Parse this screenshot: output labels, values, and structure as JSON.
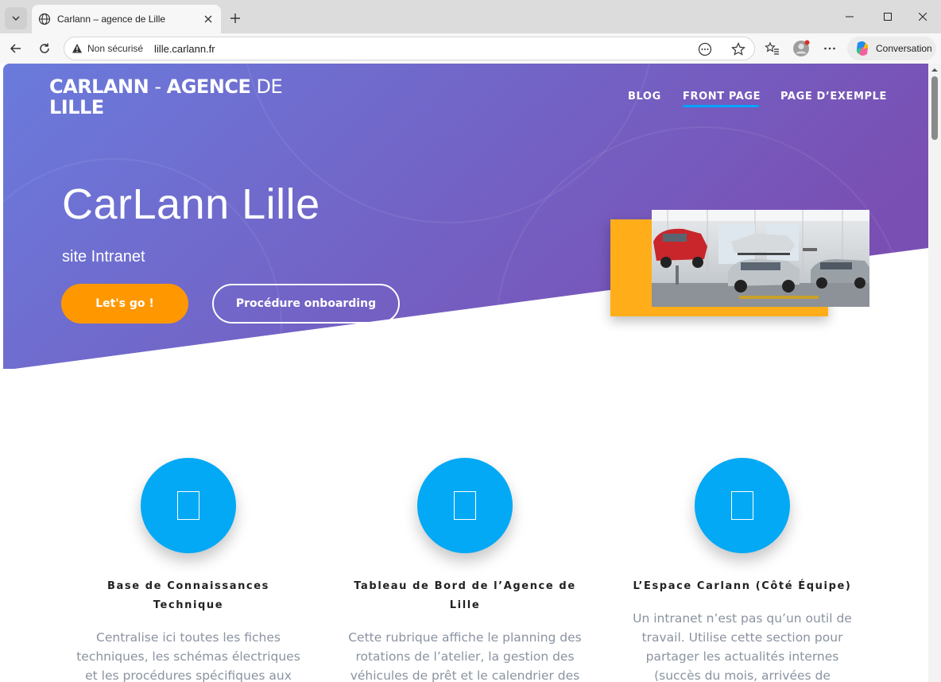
{
  "browser": {
    "tab_title": "Carlann – agence de Lille",
    "security_label": "Non sécurisé",
    "url": "lille.carlann.fr",
    "copilot_label": "Conversation"
  },
  "site": {
    "title_bold_1": "CARLANN",
    "title_sep": " - ",
    "title_bold_2": "AGENCE",
    "title_light": " DE",
    "title_bold_3": "LILLE",
    "nav": [
      {
        "label": "BLOG"
      },
      {
        "label": "FRONT PAGE",
        "active": true
      },
      {
        "label": "PAGE D’EXEMPLE"
      }
    ]
  },
  "hero": {
    "title": "CarLann Lille",
    "subtitle": "site Intranet",
    "primary_button": "Let's go !",
    "secondary_button": "Procédure onboarding"
  },
  "features": [
    {
      "icon": "document-icon",
      "title_lines": [
        "Base de Connaissances",
        "Technique"
      ],
      "text_lines": [
        "Centralise ici toutes les fiches",
        "techniques, les schémas électriques",
        "et les procédures spécifiques aux"
      ]
    },
    {
      "icon": "document-icon",
      "title_lines": [
        "Tableau de Bord de l’Agence de",
        "Lille"
      ],
      "text_lines": [
        "Cette rubrique affiche le planning des",
        "rotations de l’atelier, la gestion des",
        "véhicules de prêt et le calendrier des"
      ]
    },
    {
      "icon": "document-icon",
      "title_lines": [
        "L’Espace Carlann (Côté Équipe)"
      ],
      "text_lines": [
        "Un intranet n’est pas qu’un outil de",
        "travail. Utilise cette section pour",
        "partager les actualités internes",
        "(succès du mois, arrivées de"
      ]
    }
  ],
  "colors": {
    "hero_gradient_start": "#6a7bdc",
    "hero_gradient_end": "#7a4fb3",
    "accent_orange": "#ff9800",
    "image_frame": "#ffae1a",
    "feature_circle": "#03a9f4",
    "nav_underline": "#00a3ff"
  }
}
